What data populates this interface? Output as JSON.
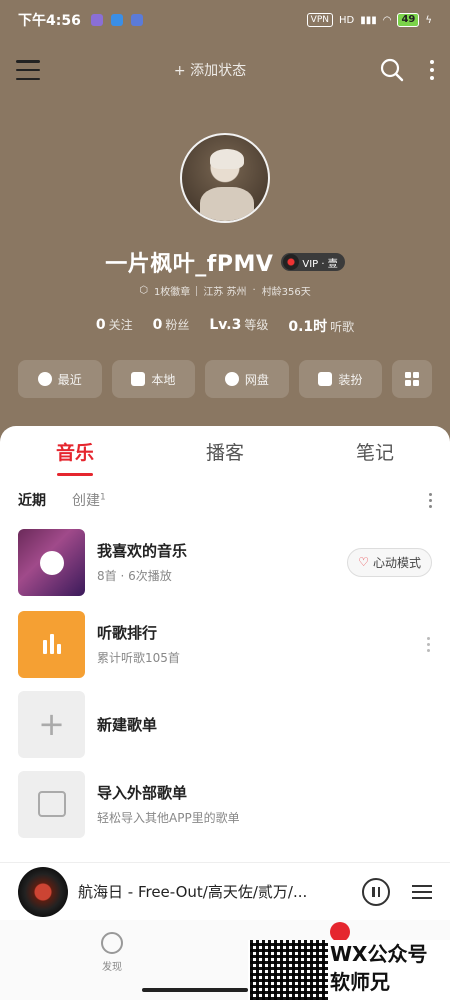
{
  "status_bar": {
    "time": "下午4:56",
    "vpn": "VPN",
    "network": "HD",
    "battery": "49"
  },
  "top_nav": {
    "add_status": "+ 添加状态"
  },
  "profile": {
    "username": "一片枫叶_fPMV",
    "vip_label": "VIP · 壹",
    "badge_count": "1枚徽章",
    "location": "江苏 苏州",
    "village_age": "村龄356天",
    "stats": [
      {
        "value": "0",
        "label": "关注"
      },
      {
        "value": "0",
        "label": "粉丝"
      },
      {
        "value": "Lv.3",
        "label": "等级"
      },
      {
        "value": "0.1时",
        "label": "听歌"
      }
    ]
  },
  "quick_actions": [
    {
      "label": "最近",
      "icon": "clock-icon"
    },
    {
      "label": "本地",
      "icon": "download-icon"
    },
    {
      "label": "网盘",
      "icon": "cloud-icon"
    },
    {
      "label": "装扮",
      "icon": "shirt-icon"
    }
  ],
  "main_tabs": [
    "音乐",
    "播客",
    "笔记"
  ],
  "sub_tabs": {
    "recent": "近期",
    "created": "创建",
    "created_count": "1"
  },
  "playlists": [
    {
      "title": "我喜欢的音乐",
      "subtitle": "8首 · 6次播放",
      "action": "心动模式"
    },
    {
      "title": "听歌排行",
      "subtitle": "累计听歌105首"
    },
    {
      "title": "新建歌单",
      "subtitle": ""
    },
    {
      "title": "导入外部歌单",
      "subtitle": "轻松导入其他APP里的歌单"
    }
  ],
  "mini_player": {
    "title": "航海日 - Free-Out/高天佐/贰万/..."
  },
  "bottom_nav": {
    "discover": "发现"
  },
  "watermark": {
    "line1": "WX公众号",
    "line2": "软师兄"
  },
  "colors": {
    "accent": "#e5262e",
    "header_bg": "#8a7762"
  }
}
